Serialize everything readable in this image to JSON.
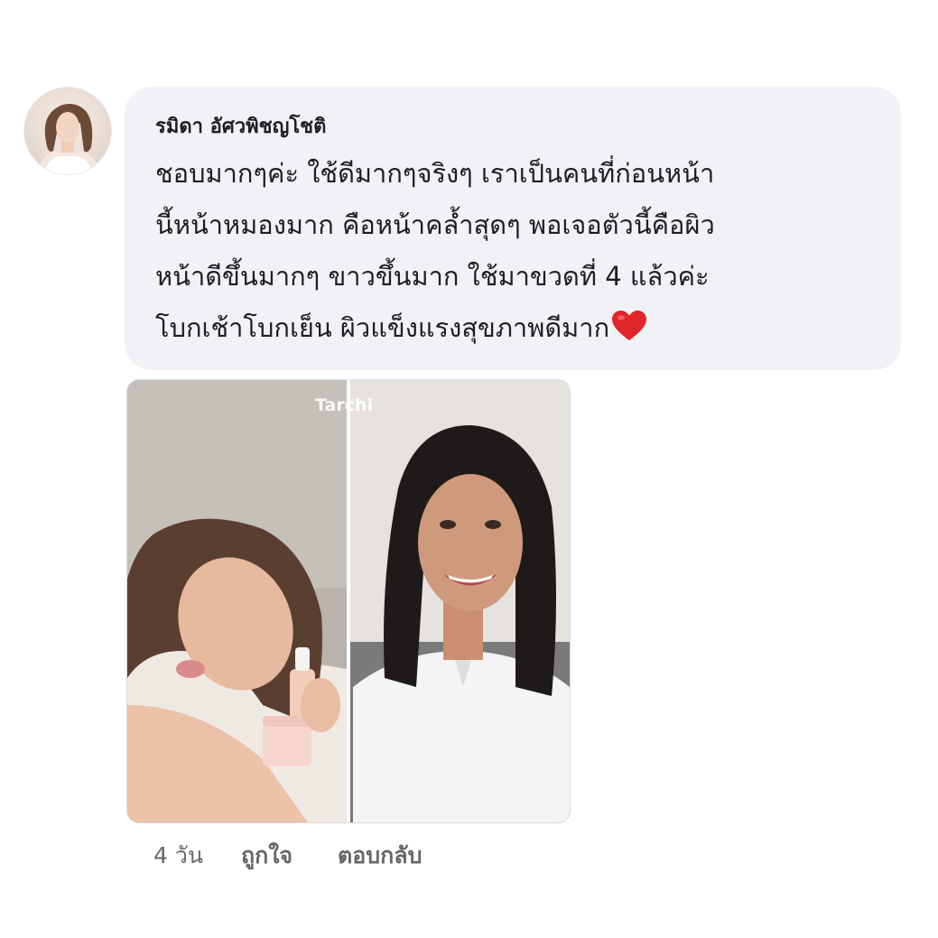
{
  "comment": {
    "author_name": "รมิดา อัศวพิชญโชติ",
    "text_lines": [
      "ชอบมากๆค่ะ ใช้ดีมากๆจริงๆ เราเป็นคนที่ก่อนหน้า",
      "นี้หน้าหมองมาก คือหน้าคล้ำสุดๆ พอเจอตัวนี้คือผิว",
      "หน้าดีขึ้นมากๆ ขาวขึ้นมาก ใช้มาขวดที่ 4 แล้วค่ะ",
      "โบกเช้าโบกเย็น ผิวแข็งแรงสุขภาพดีมาก"
    ],
    "emoji": "heart-icon"
  },
  "attachment": {
    "watermark": "Tarchi"
  },
  "actions": {
    "age": "4 วัน",
    "like_label": "ถูกใจ",
    "reply_label": "ตอบกลับ"
  },
  "colors": {
    "bubble_bg": "#f0f2f5",
    "text": "#1c1e21",
    "meta_text": "#65676b",
    "heart": "#e0262b"
  }
}
